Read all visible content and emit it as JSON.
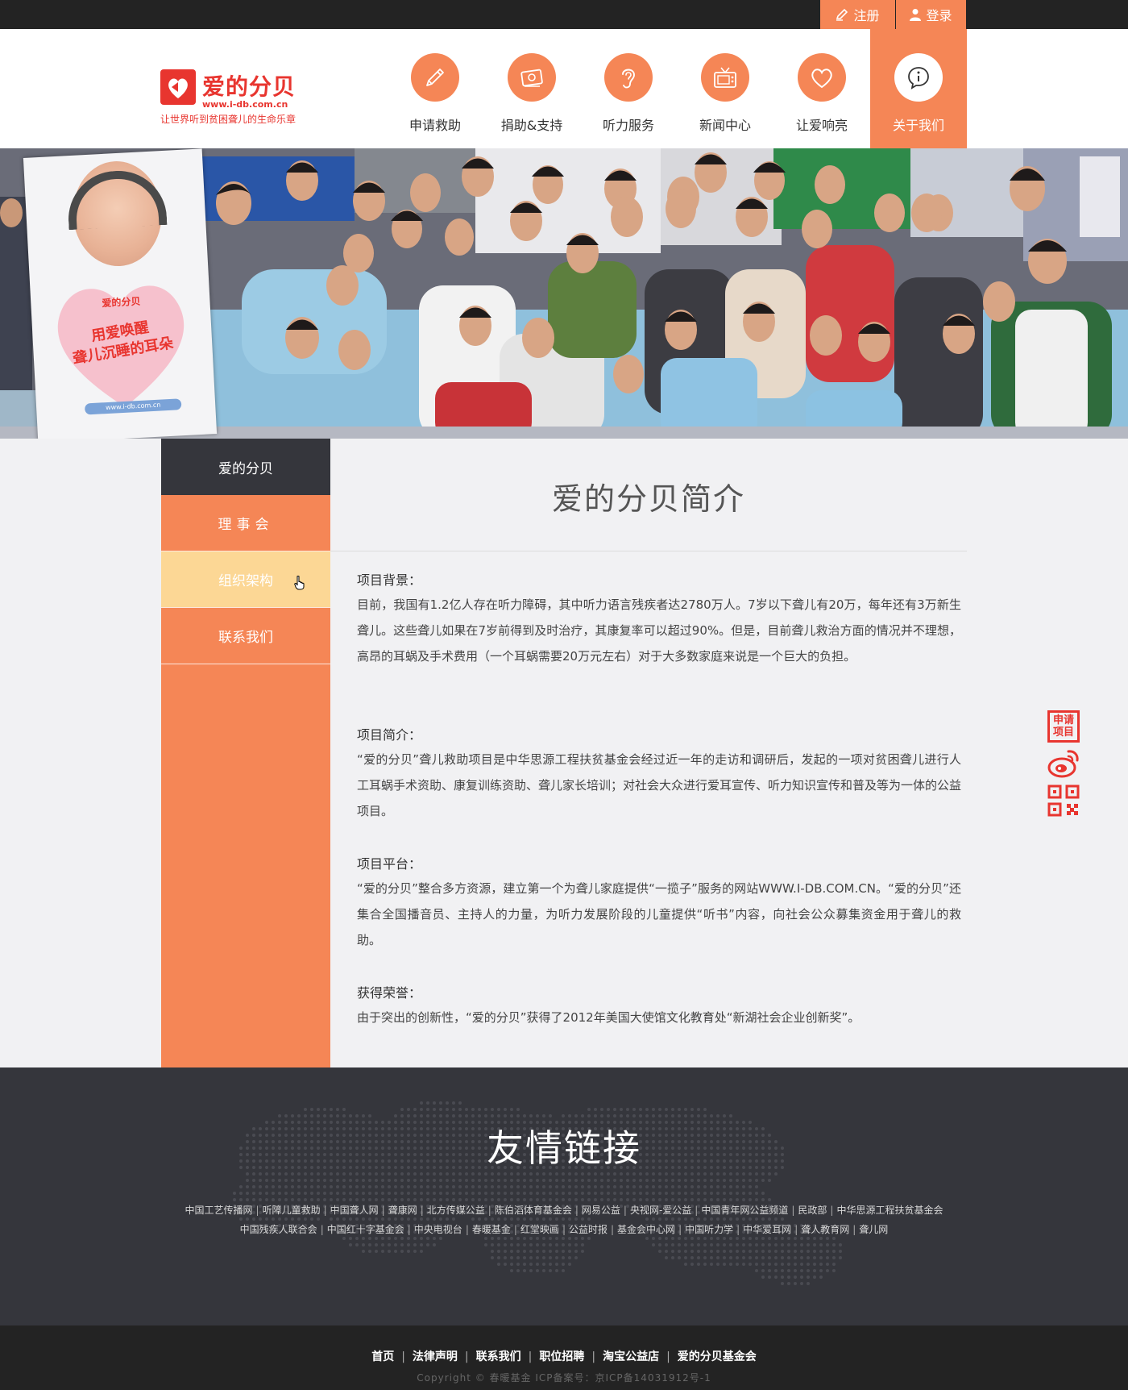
{
  "topbar": {
    "register_label": "注册",
    "login_label": "登录"
  },
  "logo": {
    "name": "爱的分贝",
    "url": "www.i-db.com.cn",
    "tagline": "让世界听到贫困聋儿的生命乐章"
  },
  "nav": [
    {
      "label": "申请救助",
      "icon": "pencil-icon"
    },
    {
      "label": "捐助&支持",
      "icon": "money-icon"
    },
    {
      "label": "听力服务",
      "icon": "ear-icon"
    },
    {
      "label": "新闻中心",
      "icon": "tv-icon"
    },
    {
      "label": "让爱响亮",
      "icon": "heart-icon"
    },
    {
      "label": "关于我们",
      "icon": "info-icon",
      "active": true
    }
  ],
  "banner": {
    "poster_logo": "爱的分贝",
    "poster_slogan_line1": "用爱唤醒",
    "poster_slogan_line2": "聋儿沉睡的耳朵",
    "poster_url": "www.i-db.com.cn"
  },
  "sidebar": {
    "header": "爱的分贝",
    "items": [
      "理事会",
      "组织架构",
      "联系我们"
    ],
    "hovered_index": 1
  },
  "content": {
    "title": "爱的分贝简介",
    "sections": [
      {
        "heading": "项目背景：",
        "body": "目前，我国有1.2亿人存在听力障碍，其中听力语言残疾者达2780万人。7岁以下聋儿有20万，每年还有3万新生聋儿。这些聋儿如果在7岁前得到及时治疗，其康复率可以超过90%。但是，目前聋儿救治方面的情况并不理想，高昂的耳蜗及手术费用（一个耳蜗需要20万元左右）对于大多数家庭来说是一个巨大的负担。"
      },
      {
        "heading": "项目简介：",
        "body": "“爱的分贝”聋儿救助项目是中华思源工程扶贫基金会经过近一年的走访和调研后，发起的一项对贫困聋儿进行人工耳蜗手术资助、康复训练资助、聋儿家长培训；对社会大众进行爱耳宣传、听力知识宣传和普及等为一体的公益项目。"
      },
      {
        "heading": "项目平台：",
        "body": "“爱的分贝”整合多方资源，建立第一个为聋儿家庭提供“一揽子”服务的网站WWW.I-DB.COM.CN。“爱的分贝”还集合全国播音员、主持人的力量，为听力发展阶段的儿童提供“听书”内容，向社会公众募集资金用于聋儿的救助。"
      },
      {
        "heading": "获得荣誉：",
        "body": "由于突出的创新性，“爱的分贝”获得了2012年美国大使馆文化教育处“新湖社会企业创新奖”。"
      }
    ]
  },
  "float": {
    "apply_label_line1": "申请",
    "apply_label_line2": "项目"
  },
  "friend_links": {
    "title": "友情链接",
    "row1": [
      "中国工艺传播网",
      "听障儿童救助",
      "中国聋人网",
      "聋康网",
      "北方传媒公益",
      "陈伯滔体育基金会",
      "网易公益",
      "央视网-爱公益",
      "中国青年网公益频道",
      "民政部",
      "中华思源工程扶贫基金会"
    ],
    "row2": [
      "中国残疾人联合会",
      "中国红十字基金会",
      "中央电视台",
      "春暖基金",
      "红堂映画",
      "公益时报",
      "基金会中心网",
      "中国听力学",
      "中华爱耳网",
      "聋人教育网",
      "聋儿网"
    ]
  },
  "footer": {
    "links": [
      "首页",
      "法律声明",
      "联系我们",
      "职位招聘",
      "淘宝公益店",
      "爱的分贝基金会"
    ],
    "copyright": "Copyright © 春暖基金 ICP备案号：京ICP备14031912号-1"
  },
  "colors": {
    "accent": "#f58656",
    "brand_red": "#e8352f",
    "dark": "#35363c",
    "hover_yellow": "#fcd795"
  }
}
